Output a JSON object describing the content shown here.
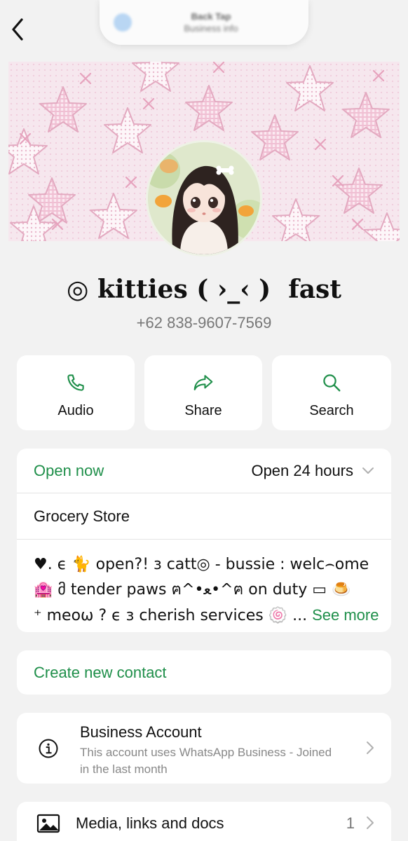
{
  "top_bar": {
    "back_icon": "chevron-left-icon",
    "pill_title": "Back Tap",
    "pill_subtitle": "Business info"
  },
  "profile": {
    "name": "◎ kitties ( ›_‹ )  fast",
    "phone": "+62 838-9607-7569"
  },
  "actions": [
    {
      "label": "Audio",
      "icon": "phone-icon"
    },
    {
      "label": "Share",
      "icon": "share-icon"
    },
    {
      "label": "Search",
      "icon": "search-icon"
    }
  ],
  "business_info": {
    "status": "Open now",
    "hours": "Open 24 hours",
    "category": "Grocery Store",
    "description_lines": [
      "♥. ϵ  🐈 open?!  з catt◎ - bussie :  welc⌢ome",
      "🏩 მ tender paws  ฅ^•ﻌ•^ฅ on duty ▭ 🍮",
      "⁺ meoω ? ϵ  з cherish services 🍥 ..."
    ],
    "see_more": "See more"
  },
  "create_contact": "Create new contact",
  "business_account": {
    "title": "Business Account",
    "subtitle": "This account uses WhatsApp Business - Joined in the last month",
    "icon": "info-icon"
  },
  "media": {
    "title": "Media, links and docs",
    "count": "1",
    "icon": "image-icon"
  },
  "colors": {
    "accent_green": "#1f8f4a",
    "background": "#f2f2f2",
    "banner_pink": "#f6e7ee"
  }
}
